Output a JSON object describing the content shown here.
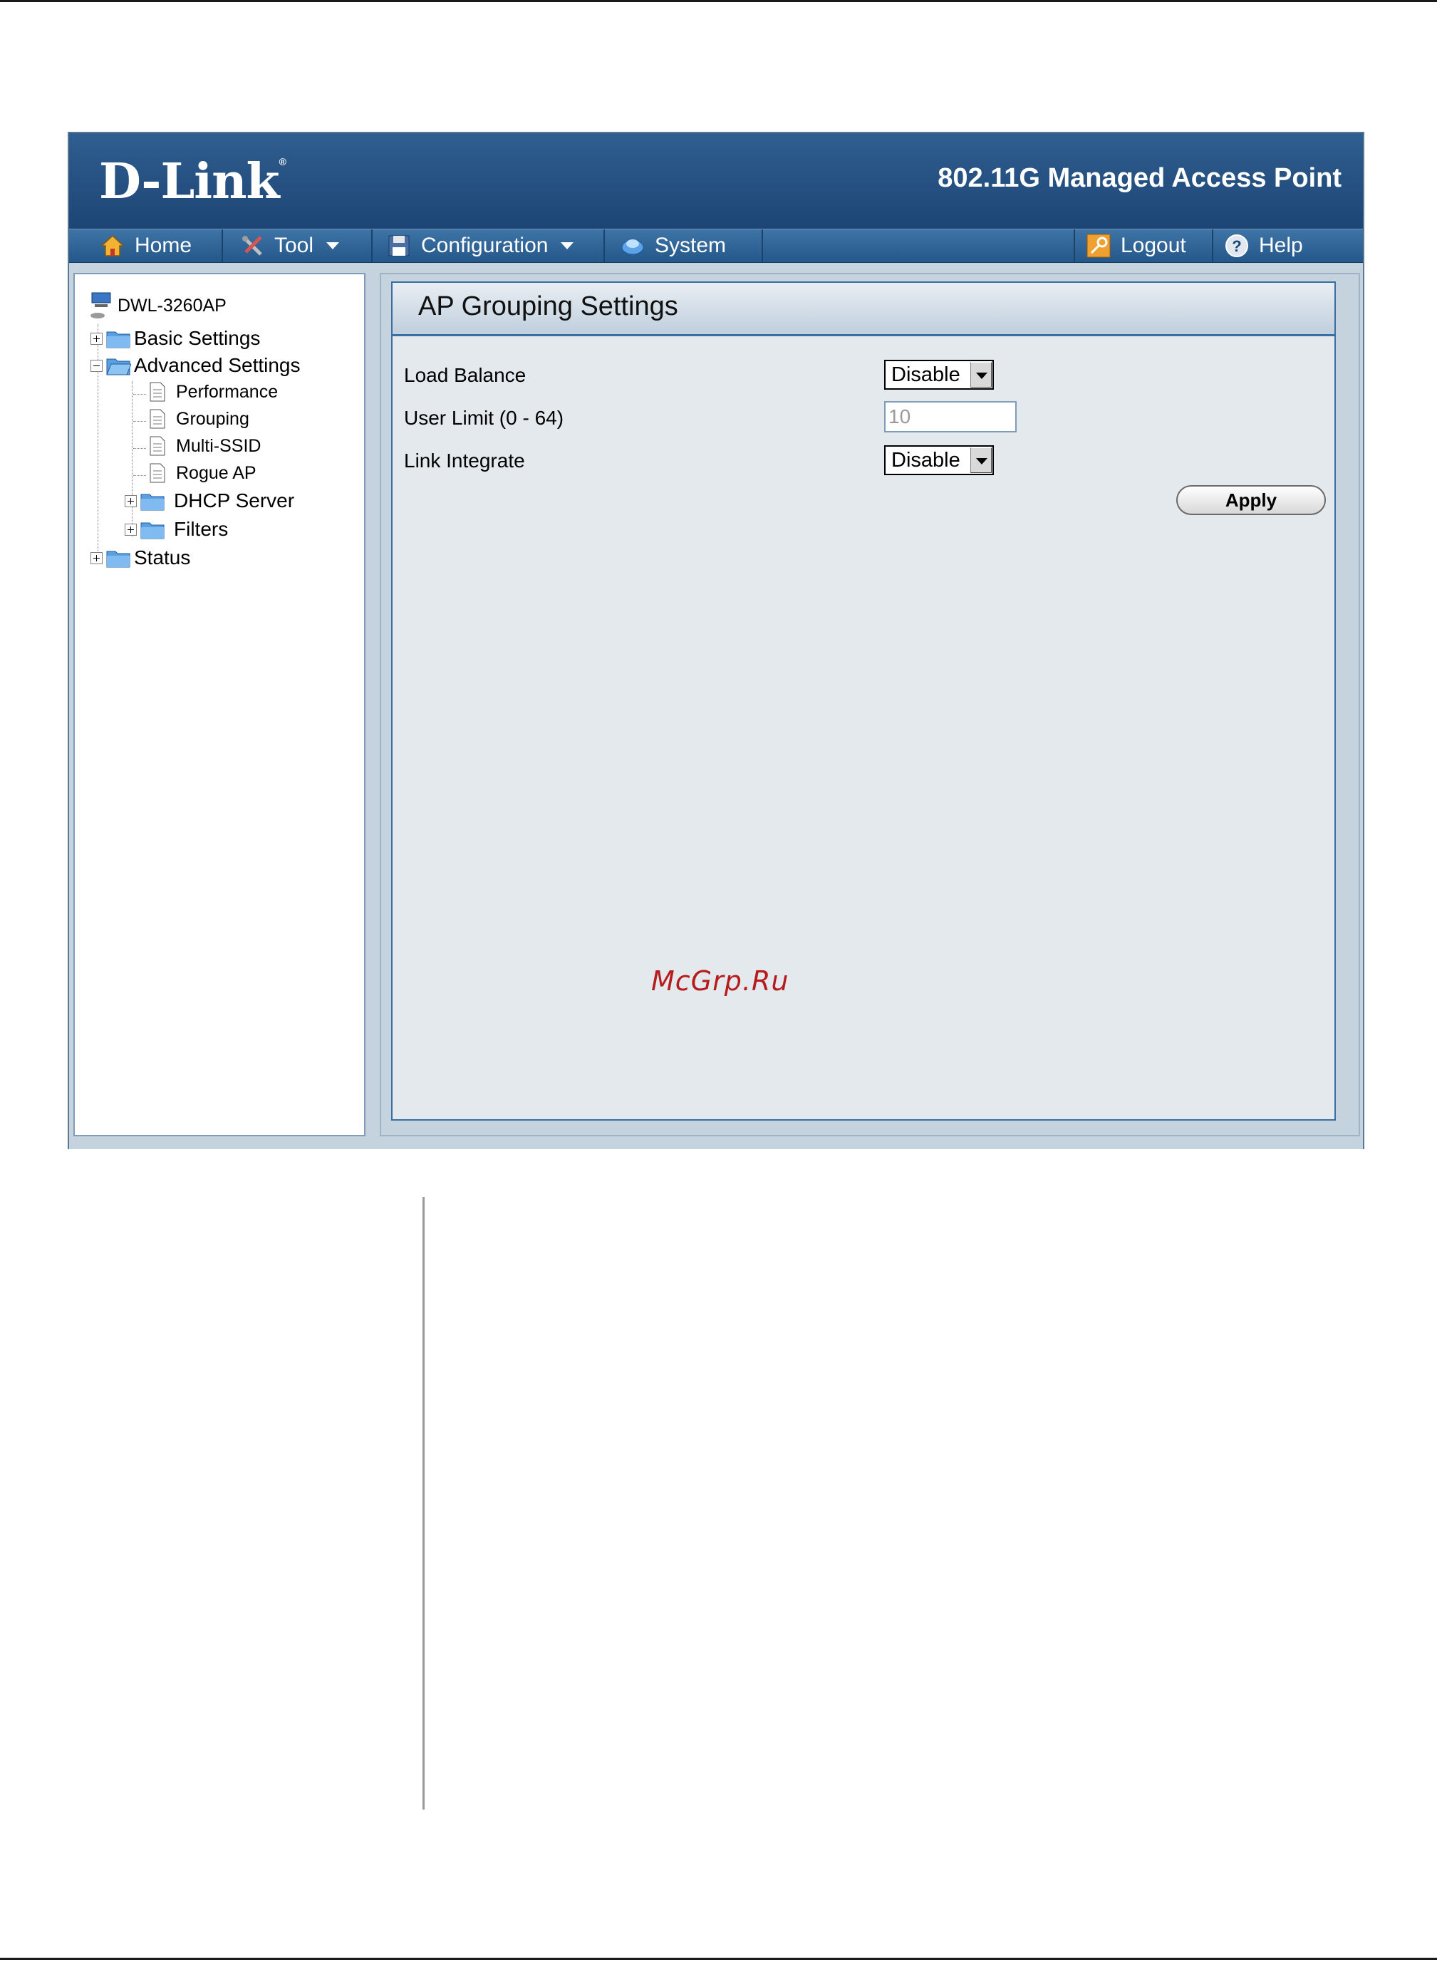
{
  "header": {
    "logo_text": "D-Link",
    "logo_mark": "®",
    "product_title": "802.11G Managed Access Point"
  },
  "menu": {
    "home": "Home",
    "tool": "Tool",
    "configuration": "Configuration",
    "system": "System",
    "logout": "Logout",
    "help": "Help"
  },
  "tree": {
    "root": "DWL-3260AP",
    "basic_settings": "Basic Settings",
    "advanced_settings": "Advanced Settings",
    "performance": "Performance",
    "grouping": "Grouping",
    "multi_ssid": "Multi-SSID",
    "rogue_ap": "Rogue AP",
    "dhcp_server": "DHCP Server",
    "filters": "Filters",
    "status": "Status"
  },
  "form": {
    "title": "AP Grouping Settings",
    "load_balance_label": "Load Balance",
    "load_balance_value": "Disable",
    "user_limit_label": "User Limit (0 - 64)",
    "user_limit_value": "10",
    "link_integrate_label": "Link Integrate",
    "link_integrate_value": "Disable",
    "apply_label": "Apply"
  },
  "watermark": "McGrp.Ru",
  "colors": {
    "header_blue": "#1c4574",
    "menu_blue": "#24578a",
    "panel_bg": "#e4e9ed",
    "border_blue": "#3b6fa3",
    "watermark_red": "#b71c1c"
  }
}
